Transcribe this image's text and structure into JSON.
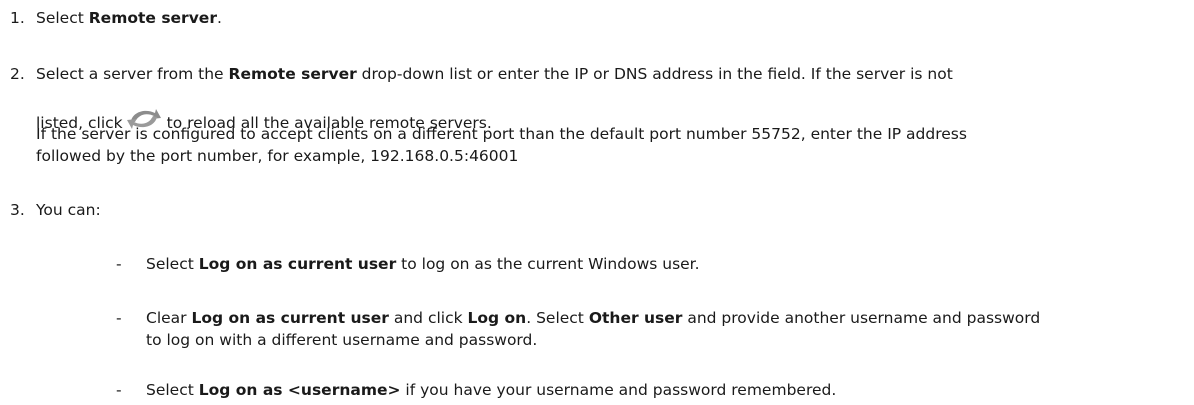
{
  "steps": [
    {
      "number": "1.",
      "parts": [
        "Select ",
        "Remote server",
        "."
      ]
    },
    {
      "number": "2.",
      "line1": [
        "Select a server from the ",
        "Remote server",
        " drop-down list or enter the IP or DNS address in the field. If the server is not"
      ],
      "line2_before_icon": "listed, click",
      "line2_after_icon": "to reload all the available remote servers.",
      "line3": "If the server is configured to accept clients on a different port than the default port number 55752, enter the IP address",
      "line4": "followed by the port number, for example, 192.168.0.5:46001"
    },
    {
      "number": "3.",
      "intro": "You can:",
      "options": [
        {
          "dash": "-",
          "line1": [
            "Select ",
            "Log on as current user",
            " to log on as the current Windows user."
          ]
        },
        {
          "dash": "-",
          "line1": [
            "Clear ",
            "Log on as current user",
            " and click ",
            "Log on",
            ". Select ",
            "Other user",
            " and provide another username and password"
          ],
          "line2": "to log on with a different username and password."
        },
        {
          "dash": "-",
          "line1": [
            "Select ",
            "Log on as <username>",
            " if you have your username and password remembered."
          ]
        }
      ]
    }
  ],
  "icons": {
    "reload": "refresh-icon",
    "reload_color": "#8a8a8a"
  }
}
